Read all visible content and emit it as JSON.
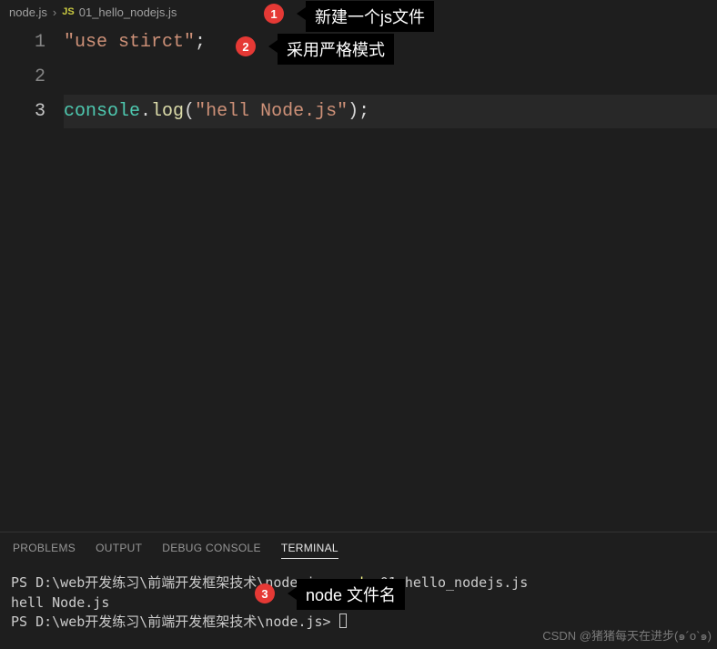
{
  "breadcrumb": {
    "folder": "node.js",
    "jsIconText": "JS",
    "filename": "01_hello_nodejs.js"
  },
  "editor": {
    "lineNumbers": [
      "1",
      "2",
      "3"
    ],
    "line1": {
      "str": "\"use stirct\"",
      "end": ";"
    },
    "line3": {
      "obj": "console",
      "dot": ".",
      "method": "log",
      "lp": "(",
      "arg": "\"hell Node.js\"",
      "rp": ")",
      "end": ";"
    }
  },
  "panel": {
    "tabs": {
      "problems": "PROBLEMS",
      "output": "OUTPUT",
      "debug": "DEBUG CONSOLE",
      "terminal": "TERMINAL"
    },
    "line1": {
      "prompt": "PS D:\\web开发练习\\前端开发框架技术\\node.js>",
      "cmd": " node",
      "arg": " 01_hello_nodejs.js"
    },
    "line2": "hell Node.js",
    "line3": {
      "prompt": "PS D:\\web开发练习\\前端开发框架技术\\node.js> "
    }
  },
  "annotations": {
    "b1": "1",
    "l1": "新建一个js文件",
    "b2": "2",
    "l2": "采用严格模式",
    "b3": "3",
    "l3": "node 文件名"
  },
  "watermark": "CSDN @猪猪每天在进步(๑´o`๑)"
}
